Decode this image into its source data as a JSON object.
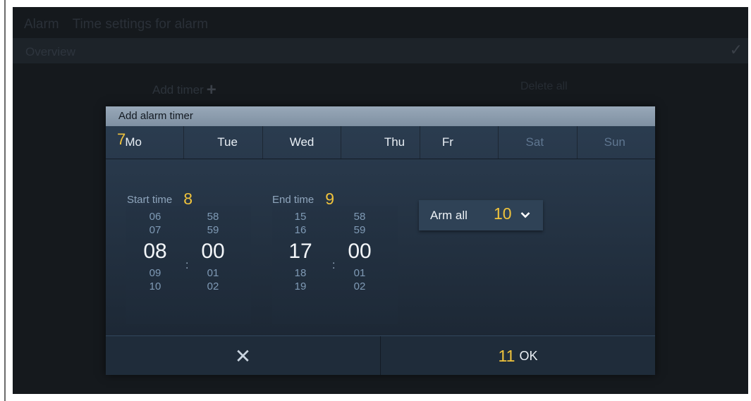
{
  "background": {
    "title_parts": [
      "Alarm",
      "Time settings for alarm"
    ],
    "overview_label": "Overview",
    "check_icon": "checkmark-icon",
    "add_timer_label": "Add timer",
    "add_icon": "plus-icon",
    "right_label": "Delete all"
  },
  "dialog": {
    "title": "Add alarm timer",
    "days": [
      {
        "label": "Mo",
        "active": true,
        "marker": "7"
      },
      {
        "label": "Tue",
        "active": true
      },
      {
        "label": "Wed",
        "active": true
      },
      {
        "label": "Thu",
        "active": true
      },
      {
        "label": "Fr",
        "active": true
      },
      {
        "label": "Sat",
        "active": false
      },
      {
        "label": "Sun",
        "active": false
      }
    ],
    "start": {
      "label": "Start time",
      "marker": "8",
      "hours": [
        "06",
        "07",
        "08",
        "09",
        "10"
      ],
      "minutes": [
        "58",
        "59",
        "00",
        "01",
        "02"
      ],
      "separator": ":"
    },
    "end": {
      "label": "End time",
      "marker": "9",
      "hours": [
        "15",
        "16",
        "17",
        "18",
        "19"
      ],
      "minutes": [
        "58",
        "59",
        "00",
        "01",
        "02"
      ],
      "separator": ":"
    },
    "arm": {
      "label": "Arm all",
      "marker": "10",
      "icon": "chevron-down-icon"
    },
    "cancel": {
      "icon": "close-icon",
      "glyph": "✕"
    },
    "ok": {
      "label": "OK",
      "marker": "11"
    }
  },
  "colors": {
    "screen_bg": "#15191d",
    "dialog_header": "#8b9bad",
    "accent_marker": "#f0c33c",
    "inactive_day": "#5f7690"
  }
}
